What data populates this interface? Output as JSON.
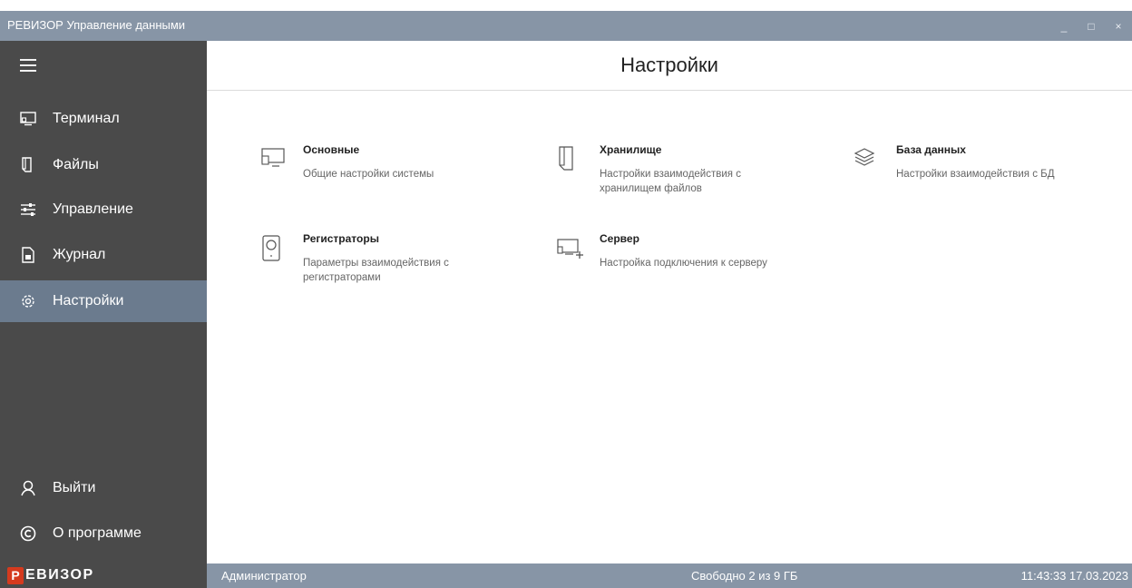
{
  "window": {
    "title": "РЕВИЗОР Управление данными",
    "controls": {
      "minimize": "_",
      "maximize": "□",
      "close": "×"
    }
  },
  "sidebar": {
    "menu_icon": "hamburger-icon",
    "items": [
      {
        "label": "Терминал",
        "icon": "terminal-icon"
      },
      {
        "label": "Файлы",
        "icon": "files-icon"
      },
      {
        "label": "Управление",
        "icon": "sliders-icon"
      },
      {
        "label": "Журнал",
        "icon": "journal-icon"
      },
      {
        "label": "Настройки",
        "icon": "gear-icon",
        "active": true
      }
    ],
    "bottom_items": [
      {
        "label": "Выйти",
        "icon": "user-icon"
      },
      {
        "label": "О программе",
        "icon": "copyright-icon"
      }
    ]
  },
  "main": {
    "title": "Настройки",
    "cards": [
      {
        "title": "Основные",
        "description": "Общие настройки системы",
        "icon": "monitor-icon"
      },
      {
        "title": "Хранилище",
        "description": "Настройки взаимодействия с хранилищем файлов",
        "icon": "storage-icon"
      },
      {
        "title": "База данных",
        "description": "Настройки взаимодействия с БД",
        "icon": "database-icon"
      },
      {
        "title": "Регистраторы",
        "description": "Параметры взаимодействия с регистраторами",
        "icon": "recorder-icon"
      },
      {
        "title": "Сервер",
        "description": "Настройка подключения к серверу",
        "icon": "server-icon"
      }
    ]
  },
  "statusbar": {
    "logo_first": "Р",
    "logo_rest": "ЕВИЗОР",
    "user": "Администратор",
    "storage": "Свободно 2 из 9 ГБ",
    "datetime": "11:43:33 17.03.2023"
  },
  "colors": {
    "titlebar": "#8795a6",
    "sidebar": "#4a4a4a",
    "active_item": "#6b7b8e",
    "logo_accent": "#d53a1e"
  }
}
